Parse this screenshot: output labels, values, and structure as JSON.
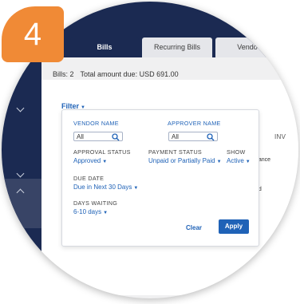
{
  "step_number": "4",
  "tabs": [
    {
      "label": "Bills",
      "active": true
    },
    {
      "label": "Recurring Bills",
      "active": false
    },
    {
      "label": "Vendo",
      "active": false
    }
  ],
  "summary": {
    "bills_count": "Bills: 2",
    "total_due": "Total amount due: USD 691.00"
  },
  "filter": {
    "toggle_label": "Filter",
    "vendor_name": {
      "label": "VENDOR NAME",
      "value": "All"
    },
    "approver_name": {
      "label": "APPROVER NAME",
      "value": "All"
    },
    "approval_status": {
      "label": "APPROVAL STATUS",
      "value": "Approved"
    },
    "payment_status": {
      "label": "PAYMENT STATUS",
      "value": "Unpaid or Partially Paid"
    },
    "show": {
      "label": "SHOW",
      "value": "Active"
    },
    "due_date": {
      "label": "DUE DATE",
      "value": "Due in Next 30 Days"
    },
    "days_waiting": {
      "label": "DAYS WAITING",
      "value": "6-10 days"
    },
    "clear_label": "Clear",
    "apply_label": "Apply"
  },
  "table": {
    "column_header": "INV",
    "row1_fragment": "nance",
    "row2_fragment": "od"
  },
  "colors": {
    "navy": "#1b2a52",
    "accent_blue": "#1f62b7",
    "badge_orange": "#f08a36"
  }
}
